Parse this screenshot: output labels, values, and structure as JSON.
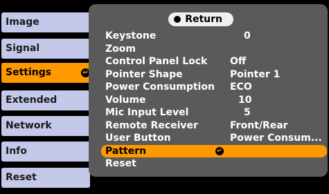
{
  "tabs": [
    {
      "label": "Image"
    },
    {
      "label": "Signal"
    },
    {
      "label": "Settings"
    },
    {
      "label": "Extended"
    },
    {
      "label": "Network"
    },
    {
      "label": "Info"
    },
    {
      "label": "Reset"
    }
  ],
  "active_tab_index": 2,
  "panel": {
    "return_label": "Return",
    "rows": [
      {
        "label": "Keystone",
        "value": "0"
      },
      {
        "label": "Zoom",
        "value": ""
      },
      {
        "label": "Control Panel Lock",
        "value": "Off"
      },
      {
        "label": "Pointer Shape",
        "value": "Pointer 1"
      },
      {
        "label": "Power Consumption",
        "value": "ECO"
      },
      {
        "label": "Volume",
        "value": "10"
      },
      {
        "label": "Mic Input Level",
        "value": "5"
      },
      {
        "label": "Remote Receiver",
        "value": "Front/Rear"
      },
      {
        "label": "User Button",
        "value": "Power Consum..."
      },
      {
        "label": "Pattern",
        "value": ""
      },
      {
        "label": "Reset",
        "value": ""
      }
    ],
    "selected_row_index": 9
  },
  "colors": {
    "accent": "#ff9900",
    "tab_bg": "#c4c9ea",
    "panel_bg": "#5a5a5a"
  },
  "icons": {
    "enter": "enter-icon"
  }
}
